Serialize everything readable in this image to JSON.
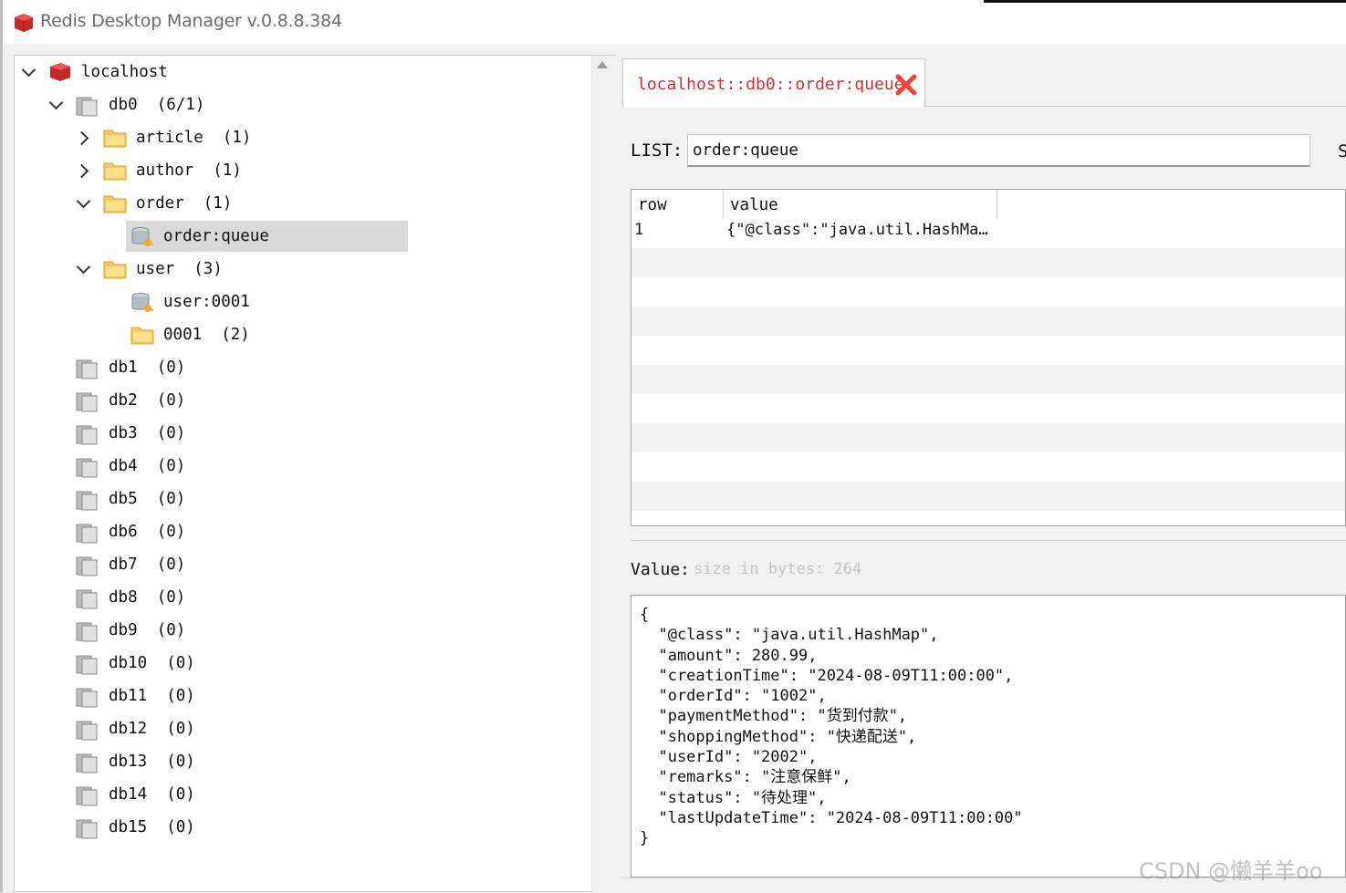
{
  "window": {
    "title": "Redis Desktop Manager v.0.8.8.384"
  },
  "tree": {
    "connection": "localhost",
    "db0": {
      "name": "db0",
      "count": "(6/1)"
    },
    "folders": [
      {
        "name": "article",
        "count": "(1)"
      },
      {
        "name": "author",
        "count": "(1)"
      },
      {
        "name": "order",
        "count": "(1)"
      }
    ],
    "order_key": "order:queue",
    "user_folder": {
      "name": "user",
      "count": "(3)"
    },
    "user_key": "user:0001",
    "user_subfolder": {
      "name": "0001",
      "count": "(2)"
    },
    "databases": [
      {
        "name": "db1",
        "count": "(0)"
      },
      {
        "name": "db2",
        "count": "(0)"
      },
      {
        "name": "db3",
        "count": "(0)"
      },
      {
        "name": "db4",
        "count": "(0)"
      },
      {
        "name": "db5",
        "count": "(0)"
      },
      {
        "name": "db6",
        "count": "(0)"
      },
      {
        "name": "db7",
        "count": "(0)"
      },
      {
        "name": "db8",
        "count": "(0)"
      },
      {
        "name": "db9",
        "count": "(0)"
      },
      {
        "name": "db10",
        "count": "(0)"
      },
      {
        "name": "db11",
        "count": "(0)"
      },
      {
        "name": "db12",
        "count": "(0)"
      },
      {
        "name": "db13",
        "count": "(0)"
      },
      {
        "name": "db14",
        "count": "(0)"
      },
      {
        "name": "db15",
        "count": "(0)"
      }
    ]
  },
  "tab": {
    "label": "localhost::db0::order:queue"
  },
  "key_editor": {
    "type_label": "LIST:",
    "key_name": "order:queue",
    "cut_label": "S"
  },
  "table": {
    "headers": [
      "row",
      "value"
    ],
    "rows": [
      {
        "row": "1",
        "value": "{\"@class\":\"java.util.HashMa…"
      }
    ]
  },
  "value_panel": {
    "label": "Value:",
    "size": "size in bytes: 264",
    "text": "{\n  \"@class\": \"java.util.HashMap\",\n  \"amount\": 280.99,\n  \"creationTime\": \"2024-08-09T11:00:00\",\n  \"orderId\": \"1002\",\n  \"paymentMethod\": \"货到付款\",\n  \"shoppingMethod\": \"快递配送\",\n  \"userId\": \"2002\",\n  \"remarks\": \"注意保鲜\",\n  \"status\": \"待处理\",\n  \"lastUpdateTime\": \"2024-08-09T11:00:00\"\n}"
  },
  "watermark": "CSDN @懒羊羊oo",
  "colors": {
    "accent_red": "#d32f2f",
    "selection": "#d9d9d9"
  }
}
